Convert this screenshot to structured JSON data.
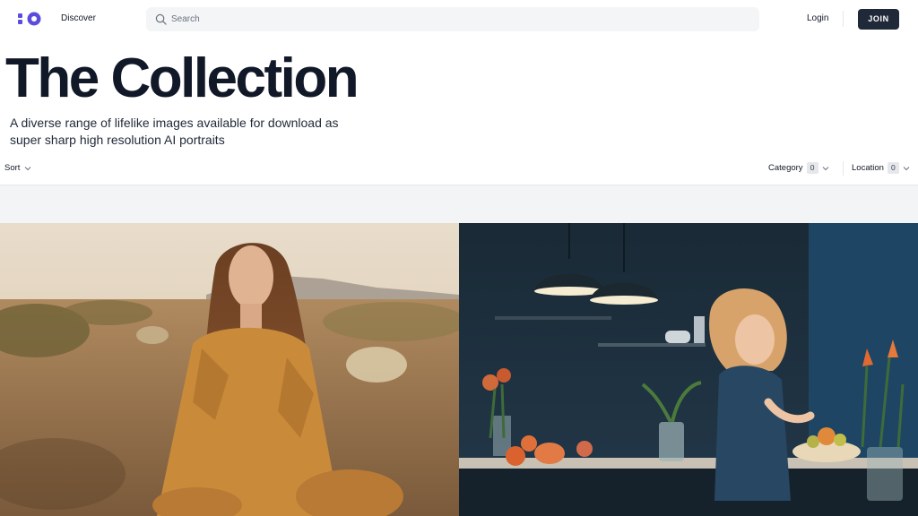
{
  "header": {
    "nav_discover": "Discover",
    "search_placeholder": "Search",
    "login_label": "Login",
    "join_label": "JOIN",
    "brand_color": "#5b4cdb"
  },
  "hero": {
    "title": "The Collection",
    "subtitle": "A diverse range of lifelike images available for download as super sharp high resolution AI portraits"
  },
  "filters": {
    "sort_label": "Sort",
    "category_label": "Category",
    "category_count": "0",
    "location_label": "Location",
    "location_count": "0"
  },
  "gallery": {
    "items": [
      {
        "description_icon": "desert-portrait-photo"
      },
      {
        "description_icon": "kitchen-child-photo"
      }
    ]
  }
}
